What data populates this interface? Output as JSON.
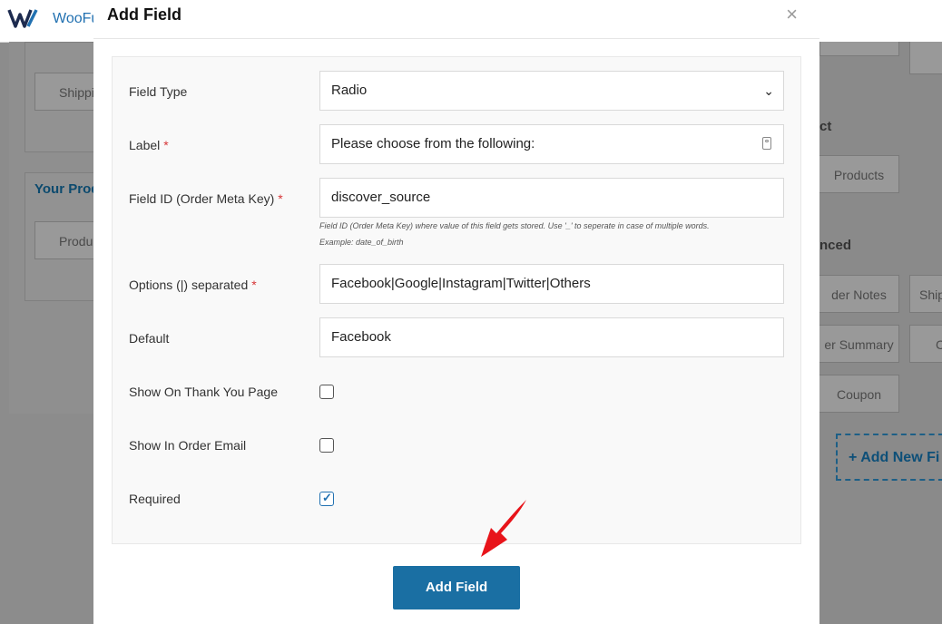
{
  "app": {
    "brand": "WooFu"
  },
  "background": {
    "left_panel_label_1": "Shipping",
    "left_btn_1": "Shippi",
    "left_link": "Your Prod",
    "left_btn_2": "Produ",
    "right_heading_1": "ct",
    "right_btn_products": "Products",
    "right_heading_2": "nced",
    "right_btn_order_notes": "der Notes",
    "right_btn_ship": "Ship",
    "right_btn_order_summary": "er Summary",
    "right_btn_c": "C",
    "right_btn_coupon": "Coupon",
    "add_new_field": "+ Add New Fi"
  },
  "modal": {
    "title": "Add Field",
    "close": "×",
    "fields": {
      "field_type": {
        "label": "Field Type",
        "value": "Radio"
      },
      "label": {
        "label": "Label",
        "required_mark": "*",
        "value": "Please choose from the following:"
      },
      "field_id": {
        "label": "Field ID (Order Meta Key)",
        "required_mark": "*",
        "value": "discover_source",
        "hint_1": "Field ID (Order Meta Key) where value of this field gets stored. Use '_' to seperate in case of multiple words.",
        "hint_2": "Example: date_of_birth"
      },
      "options": {
        "label": "Options (|) separated",
        "required_mark": "*",
        "value": "Facebook|Google|Instagram|Twitter|Others"
      },
      "default": {
        "label": "Default",
        "value": "Facebook"
      },
      "show_thank_you": {
        "label": "Show On Thank You Page",
        "checked": false
      },
      "show_email": {
        "label": "Show In Order Email",
        "checked": false
      },
      "required": {
        "label": "Required",
        "checked": true
      }
    },
    "submit_label": "Add Field"
  },
  "colors": {
    "accent": "#1a6fa3",
    "required": "#d63638",
    "arrow": "#e8141a"
  }
}
